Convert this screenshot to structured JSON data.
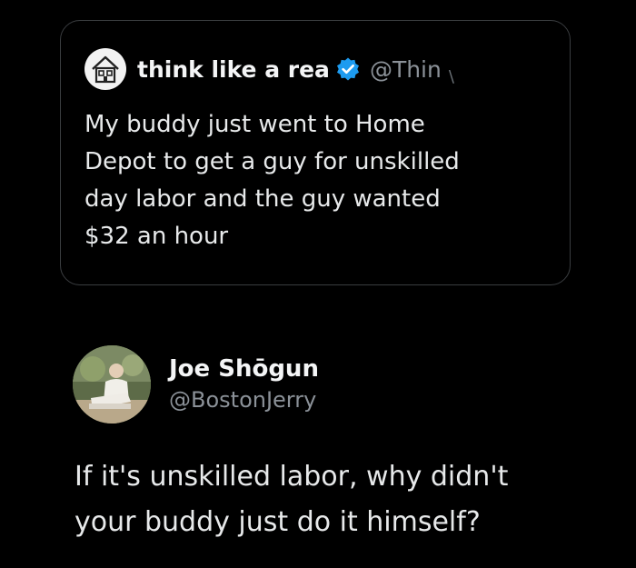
{
  "quoted_tweet": {
    "display_name": "think like a rea",
    "handle": "@Thin",
    "text": "My buddy just went to Home\nDepot to get a guy for unskilled\nday labor and the guy wanted\n$32 an hour",
    "avatar_icon": "house-logo-icon",
    "verified_icon": "verified-badge-icon",
    "verified_color": "#1d9bf0"
  },
  "reply": {
    "display_name": "Joe Shōgun",
    "handle": "@BostonJerry",
    "text": "If it's unskilled labor, why didn't\nyour buddy just do it himself?",
    "avatar_icon": "profile-photo"
  },
  "colors": {
    "background": "#000000",
    "primary_text": "#e7e9ea",
    "secondary_text": "#8b9198",
    "card_border": "#3a3d40"
  }
}
